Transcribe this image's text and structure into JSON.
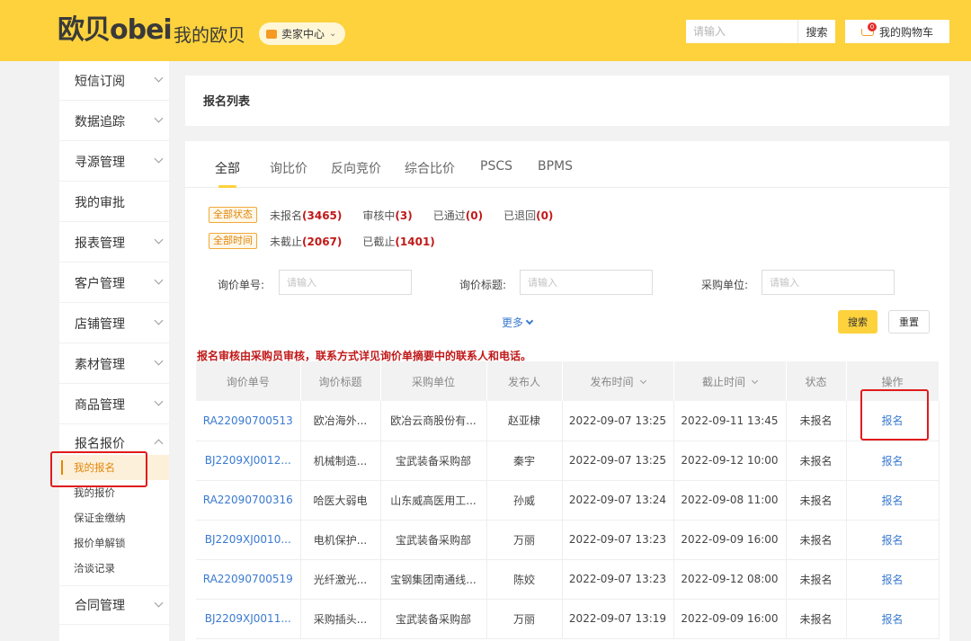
{
  "header": {
    "logo_text": "欧贝obei",
    "title": "我的欧贝",
    "seller_center": "卖家中心",
    "search_placeholder": "请输入",
    "search_button": "搜索",
    "cart": "我的购物车",
    "cart_badge": "0"
  },
  "sidebar": {
    "items": [
      {
        "label": "短信订阅",
        "chevron": "down"
      },
      {
        "label": "数据追踪",
        "chevron": "down"
      },
      {
        "label": "寻源管理",
        "chevron": "down"
      },
      {
        "label": "我的审批",
        "chevron": "none"
      },
      {
        "label": "报表管理",
        "chevron": "down"
      },
      {
        "label": "客户管理",
        "chevron": "down"
      },
      {
        "label": "店铺管理",
        "chevron": "down"
      },
      {
        "label": "素材管理",
        "chevron": "down"
      },
      {
        "label": "商品管理",
        "chevron": "down"
      },
      {
        "label": "报名报价",
        "chevron": "up"
      }
    ],
    "sub_items": [
      "我的报名",
      "我的报价",
      "保证金缴纳",
      "报价单解锁",
      "洽谈记录"
    ],
    "after_items": [
      {
        "label": "合同管理",
        "chevron": "down"
      }
    ]
  },
  "page_title": "报名列表",
  "tabs": [
    "全部",
    "询比价",
    "反向竞价",
    "综合比价",
    "PSCS",
    "BPMS"
  ],
  "filters": {
    "status_tag": "全部状态",
    "status_options": [
      {
        "label": "未报名",
        "count": "(3465)"
      },
      {
        "label": "审核中",
        "count": "(3)"
      },
      {
        "label": "已通过",
        "count": "(0)"
      },
      {
        "label": "已退回",
        "count": "(0)"
      }
    ],
    "time_tag": "全部时间",
    "time_options": [
      {
        "label": "未截止",
        "count": "(2067)"
      },
      {
        "label": "已截止",
        "count": "(1401)"
      }
    ]
  },
  "form": {
    "order_no_label": "询价单号:",
    "order_title_label": "询价标题:",
    "buyer_label": "采购单位:",
    "placeholder": "请输入",
    "more": "更多",
    "search": "搜索",
    "reset": "重置"
  },
  "notice": "报名审核由采购员审核，联系方式详见询价单摘要中的联系人和电话。",
  "table": {
    "headers": [
      "询价单号",
      "询价标题",
      "采购单位",
      "发布人",
      "发布时间",
      "截止时间",
      "状态",
      "操作"
    ],
    "rows": [
      {
        "no": "RA22090700513",
        "title": "欧冶海外...",
        "buyer": "欧冶云商股份有...",
        "publisher": "赵亚棣",
        "pub_time": "2022-09-07 13:25",
        "end_time": "2022-09-11 13:45",
        "status": "未报名",
        "action": "报名"
      },
      {
        "no": "BJ2209XJ0012...",
        "title": "机械制造...",
        "buyer": "宝武装备采购部",
        "publisher": "秦宇",
        "pub_time": "2022-09-07 13:25",
        "end_time": "2022-09-12 10:00",
        "status": "未报名",
        "action": "报名"
      },
      {
        "no": "RA22090700316",
        "title": "哈医大弱电",
        "buyer": "山东威高医用工...",
        "publisher": "孙威",
        "pub_time": "2022-09-07 13:24",
        "end_time": "2022-09-08 11:00",
        "status": "未报名",
        "action": "报名"
      },
      {
        "no": "BJ2209XJ0010...",
        "title": "电机保护...",
        "buyer": "宝武装备采购部",
        "publisher": "万丽",
        "pub_time": "2022-09-07 13:23",
        "end_time": "2022-09-09 16:00",
        "status": "未报名",
        "action": "报名"
      },
      {
        "no": "RA22090700519",
        "title": "光纤激光...",
        "buyer": "宝钢集团南通线...",
        "publisher": "陈姣",
        "pub_time": "2022-09-07 13:23",
        "end_time": "2022-09-12 08:00",
        "status": "未报名",
        "action": "报名"
      },
      {
        "no": "BJ2209XJ0011...",
        "title": "采购插头...",
        "buyer": "宝武装备采购部",
        "publisher": "万丽",
        "pub_time": "2022-09-07 13:19",
        "end_time": "2022-09-09 16:00",
        "status": "未报名",
        "action": "报名"
      }
    ]
  }
}
